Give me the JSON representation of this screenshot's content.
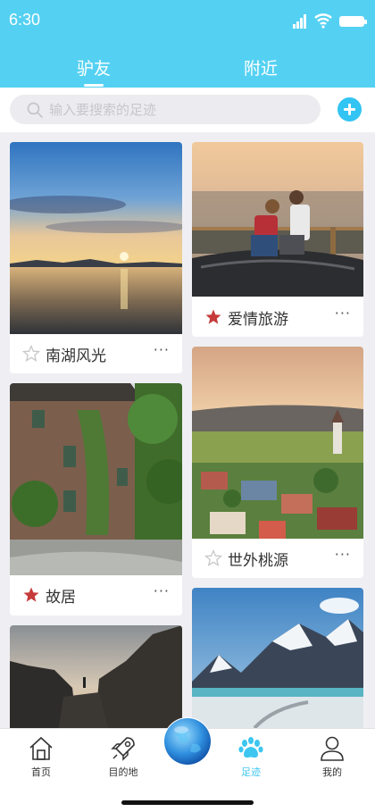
{
  "status": {
    "time": "6:30"
  },
  "tabs": [
    {
      "label": "驴友",
      "active": true
    },
    {
      "label": "附近",
      "active": false
    }
  ],
  "search": {
    "placeholder": "输入要搜索的足迹"
  },
  "cards": [
    {
      "title": "南湖风光",
      "starred": false,
      "more": "···"
    },
    {
      "title": "爱情旅游",
      "starred": true,
      "more": "···"
    },
    {
      "title": "故居",
      "starred": true,
      "more": "···"
    },
    {
      "title": "世外桃源",
      "starred": false,
      "more": "···"
    }
  ],
  "nav": [
    {
      "label": "首页",
      "icon": "home-icon"
    },
    {
      "label": "目的地",
      "icon": "rocket-icon"
    },
    {
      "label": "足迹",
      "icon": "paw-icon",
      "active": true
    },
    {
      "label": "我的",
      "icon": "user-icon"
    }
  ],
  "colors": {
    "accent": "#54d1f2",
    "active": "#3cc6f0",
    "star_on": "#c73a3a",
    "star_off": "#c8c8c8"
  }
}
